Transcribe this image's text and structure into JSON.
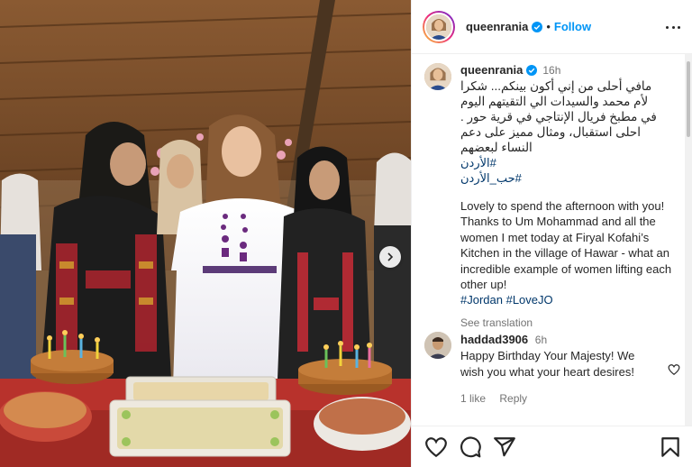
{
  "post": {
    "username": "queenrania",
    "follow_label": "Follow",
    "separator": "•"
  },
  "caption": {
    "username": "queenrania",
    "time": "16h",
    "arabic_text": "مافي أحلى من إني أكون بينكم... شكرا لأم محمد والسيدات الي التقيتهم اليوم في مطبخ فريال الإنتاجي في قرية حور . احلى استقبال، ومثال مميز على دعم النساء لبعضهم",
    "arabic_hashtags": "#الأردن #حب_الأردن",
    "english_text": "Lovely to spend the afternoon with you! Thanks to Um Mohammad and all the women I met today at Firyal Kofahi’s Kitchen in the village of Hawar - what an incredible example of women lifting each other up!",
    "english_hashtags": "#Jordan #LoveJO",
    "see_translation": "See translation"
  },
  "comment": {
    "username": "haddad3906",
    "time": "6h",
    "text": "Happy Birthday Your Majesty! We wish you what your heart desires!",
    "likes": "1 like",
    "reply": "Reply"
  },
  "icons": {
    "verified": "verified-badge-icon",
    "more": "more-options-icon",
    "like": "heart-icon",
    "comment": "comment-icon",
    "share": "share-icon",
    "save": "bookmark-icon",
    "next": "chevron-right-icon"
  },
  "colors": {
    "accent": "#0095f6",
    "hashtag": "#00376b",
    "muted": "#737373",
    "text": "#262626"
  }
}
